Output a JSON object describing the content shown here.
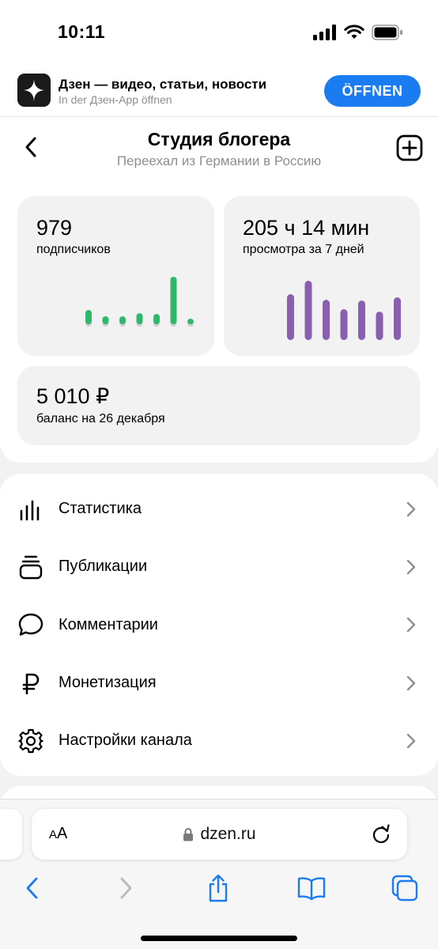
{
  "status_bar": {
    "time": "10:11"
  },
  "app_banner": {
    "title": "Дзен — видео, статьи, новости",
    "subtitle": "In der Дзен-App öffnen",
    "open_label": "ÖFFNEN",
    "accent": "#1a7cf0"
  },
  "header": {
    "title": "Студия блогера",
    "subtitle": "Переехал из Германии в Россию"
  },
  "stats": {
    "subscribers": {
      "value": "979",
      "label": "подписчиков",
      "color": "#2fb86a",
      "bars": [
        18,
        10,
        10,
        14,
        13,
        60,
        7
      ]
    },
    "views": {
      "value": "205 ч 14 мин",
      "label": "просмотра за 7 дней",
      "color": "#8a5fb0",
      "bars": [
        58,
        75,
        51,
        39,
        50,
        36,
        54
      ]
    },
    "balance": {
      "value": "5 010 ₽",
      "label": "баланс на 26 декабря"
    }
  },
  "menu": [
    {
      "label": "Статистика",
      "icon": "bar-chart-icon"
    },
    {
      "label": "Публикации",
      "icon": "stack-icon"
    },
    {
      "label": "Комментарии",
      "icon": "speech-bubble-icon"
    },
    {
      "label": "Монетизация",
      "icon": "ruble-icon"
    },
    {
      "label": "Настройки канала",
      "icon": "gear-icon"
    }
  ],
  "browser": {
    "aa_label_small": "A",
    "aa_label_big": "A",
    "url": "dzen.ru"
  }
}
